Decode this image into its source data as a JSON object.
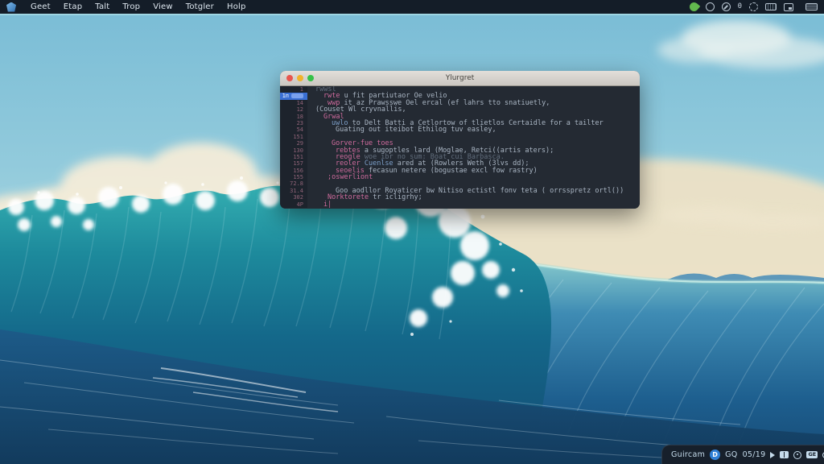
{
  "menubar": {
    "logo_icon": "distro-logo-icon",
    "items": [
      "Geet",
      "Etap",
      "Talt",
      "Trop",
      "View",
      "Totgler",
      "Holp"
    ],
    "tray": [
      {
        "name": "leaf-icon",
        "type": "leaf"
      },
      {
        "name": "network-icon",
        "type": "ring notch"
      },
      {
        "name": "update-icon",
        "type": "ring slash"
      },
      {
        "name": "zero-indicator-icon",
        "type": "zero",
        "glyph": "0"
      },
      {
        "name": "globe-icon",
        "type": "ring dotted"
      },
      {
        "name": "keyboard-icon",
        "type": "kbd"
      },
      {
        "name": "screenshot-icon",
        "type": "win"
      },
      {
        "name": "battery-icon",
        "type": "batt"
      }
    ]
  },
  "wallpaper": {
    "description": "stylized ocean wave breaking with foam, cumulus clouds and cream horizon sky",
    "palette": {
      "sky_top": "#7bbdd6",
      "sky_low": "#cfe4de",
      "horizon_cream": "#f2e3c5",
      "cloud": "#f3ecd9",
      "wave_teal": "#1d8a9c",
      "wave_deep": "#134a72",
      "swell_blue": "#3f8cb4",
      "foreground_blue": "#1d5a88",
      "foam": "#ffffff"
    }
  },
  "window": {
    "title": "Ylurgret",
    "traffic_lights": [
      "close",
      "minimize",
      "zoom"
    ],
    "code": {
      "selection_color": "#3a6fd4",
      "lines": [
        {
          "num": "1",
          "indent": 0,
          "hl": false,
          "tokens": [
            [
              "dim",
              "rwwsl"
            ]
          ]
        },
        {
          "num": "1п",
          "indent": 2,
          "hl": true,
          "tokens": [
            [
              "kw",
              "rwte"
            ],
            [
              "txt",
              " u fit partiutaor Oe velio"
            ]
          ]
        },
        {
          "num": "14",
          "indent": 3,
          "hl": false,
          "tokens": [
            [
              "kw",
              "wwp"
            ],
            [
              "txt",
              " it az Prawsswe Oel ercal (ef lahrs tto snatiuetly,"
            ]
          ]
        },
        {
          "num": "12",
          "indent": 0,
          "hl": false,
          "tokens": [
            [
              "txt",
              "(Couset Wl cryvnallis,"
            ]
          ]
        },
        {
          "num": "18",
          "indent": 2,
          "hl": false,
          "tokens": [
            [
              "kw",
              "Grwal"
            ]
          ]
        },
        {
          "num": "23",
          "indent": 4,
          "hl": false,
          "tokens": [
            [
              "blue",
              "uwlo"
            ],
            [
              "txt",
              " to Delt Batti a Cetlortow of tlietlos Certaidle for a tailter"
            ]
          ]
        },
        {
          "num": "54",
          "indent": 5,
          "hl": false,
          "tokens": [
            [
              "txt",
              "Guating out iteibot Ethilog tuv easley,"
            ]
          ]
        },
        {
          "num": "151",
          "indent": 0,
          "hl": false,
          "tokens": []
        },
        {
          "num": "29",
          "indent": 4,
          "hl": false,
          "tokens": [
            [
              "kw",
              "Gorver-fue toes"
            ]
          ]
        },
        {
          "num": "130",
          "indent": 5,
          "hl": false,
          "tokens": [
            [
              "kw",
              "rebtes"
            ],
            [
              "txt",
              " a sugoptles lard (Moglae, Retci((artis aters);"
            ]
          ]
        },
        {
          "num": "151",
          "indent": 5,
          "hl": false,
          "tokens": [
            [
              "kw",
              "reogle"
            ],
            [
              "dim",
              " woe ibr no sum: Boat cui Barbasca."
            ]
          ]
        },
        {
          "num": "157",
          "indent": 5,
          "hl": false,
          "tokens": [
            [
              "kw",
              "reoler"
            ],
            [
              "blue",
              " Cuenlse"
            ],
            [
              "txt",
              " ared at (Rowlers Weth (3lvs dd);"
            ]
          ]
        },
        {
          "num": "156",
          "indent": 5,
          "hl": false,
          "tokens": [
            [
              "kw",
              "seoelis"
            ],
            [
              "txt",
              " fecasun netere (bogustae excl fow rastry)"
            ]
          ]
        },
        {
          "num": "155",
          "indent": 3,
          "hl": false,
          "tokens": [
            [
              "kw",
              ";oswerliont"
            ]
          ]
        },
        {
          "num": "72.8",
          "indent": 0,
          "hl": false,
          "tokens": []
        },
        {
          "num": "31.4",
          "indent": 5,
          "hl": false,
          "tokens": [
            [
              "txt",
              "Goo aodllor Royaticer bw Nitiso ectistl fonv teta ( orrsspretz ortl())"
            ]
          ]
        },
        {
          "num": "302",
          "indent": 3,
          "hl": false,
          "tokens": [
            [
              "kw",
              "Norktorete"
            ],
            [
              "txt",
              " tr icligrhy;"
            ]
          ]
        },
        {
          "num": "4P",
          "indent": 2,
          "hl": false,
          "tokens": [
            [
              "kw",
              "i|"
            ]
          ]
        }
      ]
    }
  },
  "taskbar": {
    "app_label": "Guircam",
    "badge_letter": "D",
    "label_gq": "GQ",
    "clock": "05/19",
    "icons": [
      {
        "name": "play-icon",
        "type": "play"
      },
      {
        "name": "book-icon",
        "type": "book"
      },
      {
        "name": "status-ring-icon",
        "type": "ring"
      },
      {
        "name": "ge-badge-icon",
        "type": "ge",
        "label": "GE"
      },
      {
        "name": "pill-indicator-icon",
        "type": "pill"
      },
      {
        "name": "edge-handle-icon",
        "type": "edge"
      }
    ]
  }
}
